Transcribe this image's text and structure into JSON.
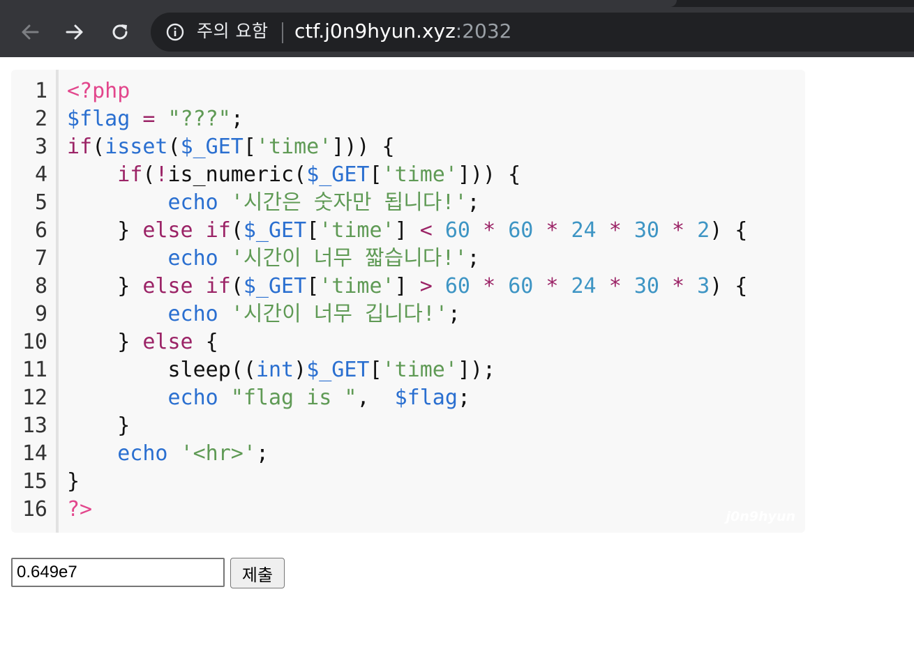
{
  "browser": {
    "nav": {
      "back_icon": "back-arrow-icon",
      "forward_icon": "forward-arrow-icon",
      "reload_icon": "reload-icon"
    },
    "omnibox": {
      "security_icon": "info-circle-icon",
      "security_text": "주의 요함",
      "url_host": "ctf.j0n9hyun.xyz",
      "url_port": ":2032"
    }
  },
  "code": {
    "line_numbers": [
      "1",
      "2",
      "3",
      "4",
      "5",
      "6",
      "7",
      "8",
      "9",
      "10",
      "11",
      "12",
      "13",
      "14",
      "15",
      "16"
    ],
    "lines": [
      [
        {
          "t": "<?php",
          "c": "tag"
        }
      ],
      [
        {
          "t": "$flag",
          "c": "var"
        },
        {
          "t": " "
        },
        {
          "t": "=",
          "c": "op"
        },
        {
          "t": " "
        },
        {
          "t": "\"???\"",
          "c": "str"
        },
        {
          "t": ";"
        }
      ],
      [
        {
          "t": "if",
          "c": "kw"
        },
        {
          "t": "("
        },
        {
          "t": "isset",
          "c": "fn"
        },
        {
          "t": "("
        },
        {
          "t": "$_GET",
          "c": "var"
        },
        {
          "t": "["
        },
        {
          "t": "'time'",
          "c": "str"
        },
        {
          "t": "])) {"
        }
      ],
      [
        {
          "t": "    "
        },
        {
          "t": "if",
          "c": "kw"
        },
        {
          "t": "("
        },
        {
          "t": "!",
          "c": "op"
        },
        {
          "t": "is_numeric("
        },
        {
          "t": "$_GET",
          "c": "var"
        },
        {
          "t": "["
        },
        {
          "t": "'time'",
          "c": "str"
        },
        {
          "t": "])) {"
        }
      ],
      [
        {
          "t": "        "
        },
        {
          "t": "echo",
          "c": "fn"
        },
        {
          "t": " "
        },
        {
          "t": "'시간은 숫자만 됩니다!'",
          "c": "str"
        },
        {
          "t": ";"
        }
      ],
      [
        {
          "t": "    } "
        },
        {
          "t": "else",
          "c": "kw"
        },
        {
          "t": " "
        },
        {
          "t": "if",
          "c": "kw"
        },
        {
          "t": "("
        },
        {
          "t": "$_GET",
          "c": "var"
        },
        {
          "t": "["
        },
        {
          "t": "'time'",
          "c": "str"
        },
        {
          "t": "] "
        },
        {
          "t": "<",
          "c": "op"
        },
        {
          "t": " "
        },
        {
          "t": "60",
          "c": "num"
        },
        {
          "t": " "
        },
        {
          "t": "*",
          "c": "op"
        },
        {
          "t": " "
        },
        {
          "t": "60",
          "c": "num"
        },
        {
          "t": " "
        },
        {
          "t": "*",
          "c": "op"
        },
        {
          "t": " "
        },
        {
          "t": "24",
          "c": "num"
        },
        {
          "t": " "
        },
        {
          "t": "*",
          "c": "op"
        },
        {
          "t": " "
        },
        {
          "t": "30",
          "c": "num"
        },
        {
          "t": " "
        },
        {
          "t": "*",
          "c": "op"
        },
        {
          "t": " "
        },
        {
          "t": "2",
          "c": "num"
        },
        {
          "t": ") {"
        }
      ],
      [
        {
          "t": "        "
        },
        {
          "t": "echo",
          "c": "fn"
        },
        {
          "t": " "
        },
        {
          "t": "'시간이 너무 짧습니다!'",
          "c": "str"
        },
        {
          "t": ";"
        }
      ],
      [
        {
          "t": "    } "
        },
        {
          "t": "else",
          "c": "kw"
        },
        {
          "t": " "
        },
        {
          "t": "if",
          "c": "kw"
        },
        {
          "t": "("
        },
        {
          "t": "$_GET",
          "c": "var"
        },
        {
          "t": "["
        },
        {
          "t": "'time'",
          "c": "str"
        },
        {
          "t": "] "
        },
        {
          "t": ">",
          "c": "op"
        },
        {
          "t": " "
        },
        {
          "t": "60",
          "c": "num"
        },
        {
          "t": " "
        },
        {
          "t": "*",
          "c": "op"
        },
        {
          "t": " "
        },
        {
          "t": "60",
          "c": "num"
        },
        {
          "t": " "
        },
        {
          "t": "*",
          "c": "op"
        },
        {
          "t": " "
        },
        {
          "t": "24",
          "c": "num"
        },
        {
          "t": " "
        },
        {
          "t": "*",
          "c": "op"
        },
        {
          "t": " "
        },
        {
          "t": "30",
          "c": "num"
        },
        {
          "t": " "
        },
        {
          "t": "*",
          "c": "op"
        },
        {
          "t": " "
        },
        {
          "t": "3",
          "c": "num"
        },
        {
          "t": ") {"
        }
      ],
      [
        {
          "t": "        "
        },
        {
          "t": "echo",
          "c": "fn"
        },
        {
          "t": " "
        },
        {
          "t": "'시간이 너무 깁니다!'",
          "c": "str"
        },
        {
          "t": ";"
        }
      ],
      [
        {
          "t": "    } "
        },
        {
          "t": "else",
          "c": "kw"
        },
        {
          "t": " {"
        }
      ],
      [
        {
          "t": "        sleep(("
        },
        {
          "t": "int",
          "c": "fn"
        },
        {
          "t": ")"
        },
        {
          "t": "$_GET",
          "c": "var"
        },
        {
          "t": "["
        },
        {
          "t": "'time'",
          "c": "str"
        },
        {
          "t": "]);"
        }
      ],
      [
        {
          "t": "        "
        },
        {
          "t": "echo",
          "c": "fn"
        },
        {
          "t": " "
        },
        {
          "t": "\"flag is \"",
          "c": "str"
        },
        {
          "t": ",  "
        },
        {
          "t": "$flag",
          "c": "var"
        },
        {
          "t": ";"
        }
      ],
      [
        {
          "t": "    }"
        }
      ],
      [
        {
          "t": "    "
        },
        {
          "t": "echo",
          "c": "fn"
        },
        {
          "t": " "
        },
        {
          "t": "'<hr>'",
          "c": "str"
        },
        {
          "t": ";"
        }
      ],
      [
        {
          "t": "}"
        }
      ],
      [
        {
          "t": "?>",
          "c": "tag"
        }
      ]
    ],
    "watermark": "j0n9hyun"
  },
  "form": {
    "time_value": "0.649e7",
    "submit_label": "제출"
  },
  "colors": {
    "tag": "#e2468c",
    "variable": "#2a6fd0",
    "operator": "#9b2366",
    "string": "#5f9a55",
    "number": "#3e95c4",
    "keyword": "#9b2366"
  }
}
